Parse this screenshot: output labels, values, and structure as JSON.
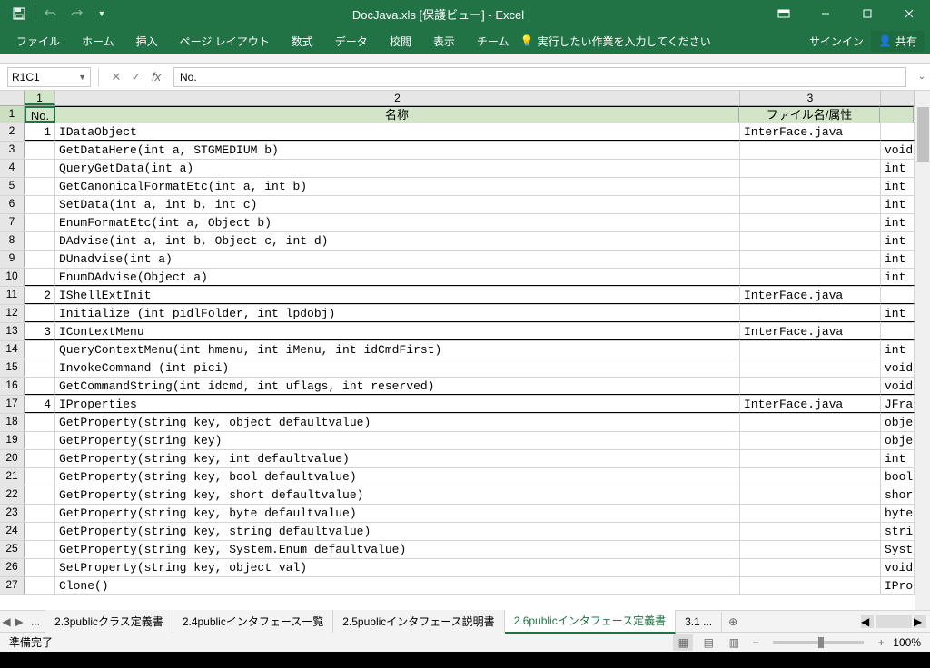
{
  "title": "DocJava.xls [保護ビュー] - Excel",
  "qat": {
    "save": "💾"
  },
  "ribbon": {
    "tabs": [
      "ファイル",
      "ホーム",
      "挿入",
      "ページ レイアウト",
      "数式",
      "データ",
      "校閲",
      "表示",
      "チーム"
    ],
    "tell": "実行したい作業を入力してください",
    "signin": "サインイン",
    "share": "共有"
  },
  "namebox": "R1C1",
  "formula": "No.",
  "columns": {
    "c1": "1",
    "c2": "2",
    "c3": "3"
  },
  "headers": {
    "no": "No.",
    "name": "名称",
    "file": "ファイル名/属性"
  },
  "col_widths": {
    "rownum": 27,
    "no": 34,
    "name": 754,
    "file": 155,
    "ret": 37
  },
  "rows": [
    {
      "r": 1,
      "hdr": true
    },
    {
      "r": 2,
      "no": "1",
      "name": "IDataObject",
      "file": "InterFace.java",
      "ret": "",
      "bb": true
    },
    {
      "r": 3,
      "name": "GetDataHere(int a, STGMEDIUM b)",
      "ret": "void"
    },
    {
      "r": 4,
      "name": "QueryGetData(int a)",
      "ret": "int"
    },
    {
      "r": 5,
      "name": "GetCanonicalFormatEtc(int a, int b)",
      "ret": "int"
    },
    {
      "r": 6,
      "name": "SetData(int a, int b, int c)",
      "ret": "int"
    },
    {
      "r": 7,
      "name": "EnumFormatEtc(int a, Object b)",
      "ret": "int"
    },
    {
      "r": 8,
      "name": "DAdvise(int a, int b, Object c, int d)",
      "ret": "int"
    },
    {
      "r": 9,
      "name": "DUnadvise(int a)",
      "ret": "int"
    },
    {
      "r": 10,
      "name": "EnumDAdvise(Object a)",
      "ret": "int",
      "bb": true
    },
    {
      "r": 11,
      "no": "2",
      "name": "IShellExtInit",
      "file": "InterFace.java",
      "bb": true
    },
    {
      "r": 12,
      "name": "Initialize (int pidlFolder, int lpdobj)",
      "ret": "int",
      "bb": true
    },
    {
      "r": 13,
      "no": "3",
      "name": "IContextMenu",
      "file": "InterFace.java",
      "bb": true
    },
    {
      "r": 14,
      "name": "QueryContextMenu(int hmenu, int iMenu, int idCmdFirst)",
      "ret": "int"
    },
    {
      "r": 15,
      "name": "InvokeCommand (int pici)",
      "ret": "void"
    },
    {
      "r": 16,
      "name": "GetCommandString(int idcmd, int uflags, int reserved)",
      "ret": "void",
      "bb": true
    },
    {
      "r": 17,
      "no": "4",
      "name": "IProperties",
      "file": "InterFace.java",
      "ret": "JFra",
      "bb": true
    },
    {
      "r": 18,
      "name": "GetProperty(string key, object defaultvalue)",
      "ret": "obje"
    },
    {
      "r": 19,
      "name": "GetProperty(string key)",
      "ret": "obje"
    },
    {
      "r": 20,
      "name": "GetProperty(string key, int defaultvalue)",
      "ret": "int"
    },
    {
      "r": 21,
      "name": "GetProperty(string key, bool defaultvalue)",
      "ret": "bool"
    },
    {
      "r": 22,
      "name": "GetProperty(string key, short defaultvalue)",
      "ret": "shor"
    },
    {
      "r": 23,
      "name": "GetProperty(string key, byte defaultvalue)",
      "ret": "byte"
    },
    {
      "r": 24,
      "name": "GetProperty(string key, string defaultvalue)",
      "ret": "stri"
    },
    {
      "r": 25,
      "name": "GetProperty(string key, System.Enum defaultvalue)",
      "ret": "Syst"
    },
    {
      "r": 26,
      "name": "SetProperty(string key, object val)",
      "ret": "void"
    },
    {
      "r": 27,
      "name": "Clone()",
      "ret": "IPro"
    }
  ],
  "tabs": {
    "list": [
      "...",
      "2.3publicクラス定義書",
      "2.4publicインタフェース一覧",
      "2.5publicインタフェース説明書",
      "2.6publicインタフェース定義書",
      "3.1 ..."
    ],
    "active": 4
  },
  "status": {
    "ready": "準備完了",
    "zoom": "100%"
  },
  "taskbar_time": ""
}
